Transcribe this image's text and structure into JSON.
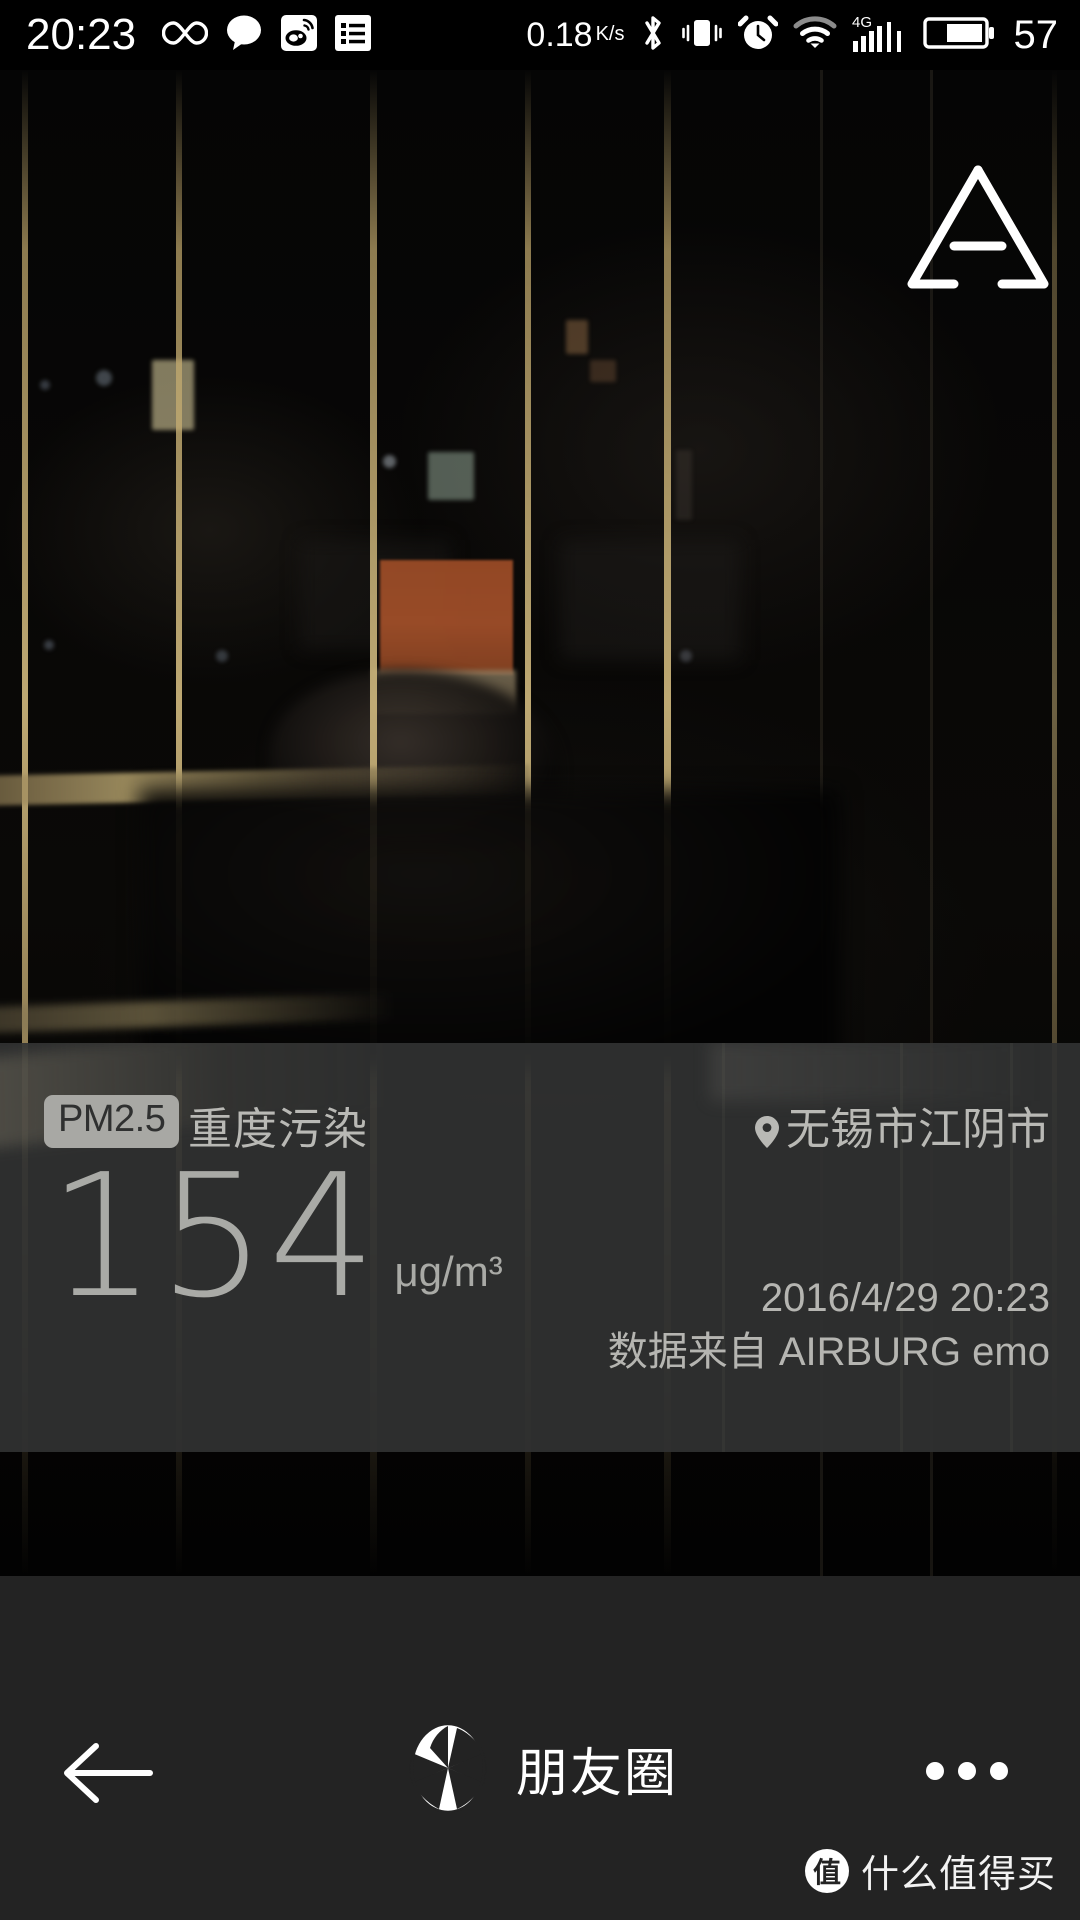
{
  "statusbar": {
    "clock": "20:23",
    "network_speed": "0.18",
    "network_speed_unit": "K/s",
    "battery_percent": "57",
    "icons": [
      "infinity-icon",
      "chat-bubble-icon",
      "weibo-icon",
      "list-icon",
      "bluetooth-icon",
      "vibrate-icon",
      "alarm-clock-icon",
      "wifi-icon",
      "signal-4g-icon",
      "battery-icon"
    ]
  },
  "photo": {
    "logo_name": "airburg-triangle-logo"
  },
  "pm_panel": {
    "badge_label": "PM2.5",
    "level_label": "重度污染",
    "location": "无锡市江阴市",
    "location_icon": "location-pin-icon",
    "value": "154",
    "unit": "μg/m³",
    "timestamp": "2016/4/29 20:23",
    "source": "数据来自 AIRBURG emo"
  },
  "toolbar": {
    "back_icon": "back-arrow-icon",
    "share_icon": "camera-aperture-icon",
    "share_label": "朋友圈",
    "more_icon": "more-dots-icon"
  },
  "watermark": {
    "badge": "值",
    "text": "什么值得买"
  },
  "colors": {
    "panel_bg": "#303131",
    "panel_text": "#b9b9b5",
    "badge_bg": "#a8a8a4",
    "badge_text": "#2f3030",
    "toolbar_bg": "#232323",
    "statusbar_bg": "#000000",
    "value_text": "#a9aaa6"
  }
}
